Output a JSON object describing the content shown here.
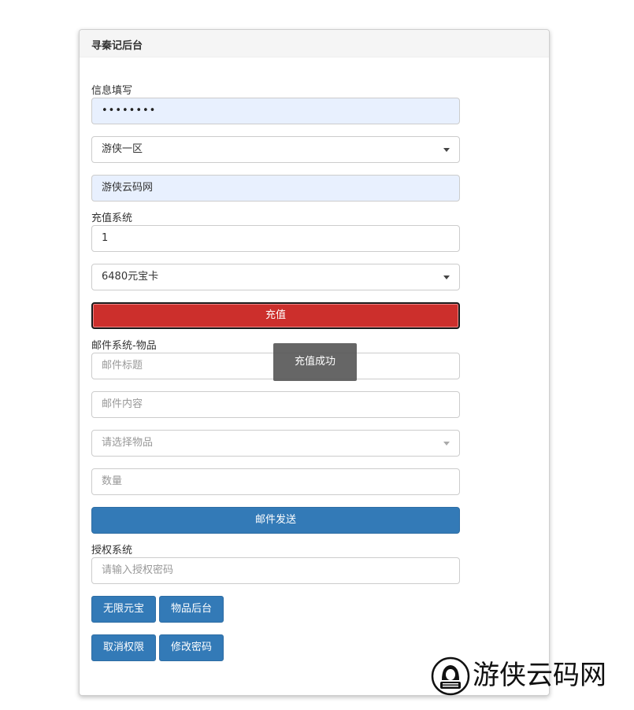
{
  "panel": {
    "title": "寻秦记后台"
  },
  "info_section": {
    "label": "信息填写",
    "password_value": "••••••••",
    "server_select": "游侠一区",
    "role_value": "游侠云码网"
  },
  "recharge_section": {
    "label": "充值系统",
    "quantity_value": "1",
    "item_select": "6480元宝卡",
    "submit_label": "充值",
    "button_color": "#cc2f2c"
  },
  "mail_section": {
    "label": "邮件系统-物品",
    "title_placeholder": "邮件标题",
    "content_placeholder": "邮件内容",
    "item_select_placeholder": "请选择物品",
    "quantity_placeholder": "数量",
    "send_label": "邮件发送"
  },
  "auth_section": {
    "label": "授权系统",
    "password_placeholder": "请输入授权密码",
    "buttons": [
      "无限元宝",
      "物品后台",
      "取消权限",
      "修改密码"
    ]
  },
  "toast": {
    "message": "充值成功"
  },
  "watermark": {
    "text": "游侠云码网"
  },
  "colors": {
    "primary": "#337ab7",
    "danger": "#cc2f2c",
    "autofill": "#e8f0fe"
  }
}
